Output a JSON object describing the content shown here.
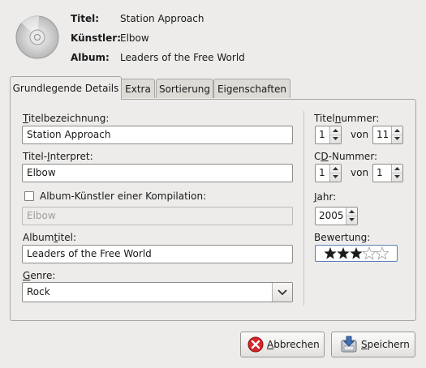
{
  "header": {
    "title_label": "Titel:",
    "title_value": "Station Approach",
    "artist_label": "Künstler:",
    "artist_value": "Elbow",
    "album_label": "Album:",
    "album_value": "Leaders of the Free World"
  },
  "tabs": [
    {
      "label": "Grundlegende Details",
      "active": true
    },
    {
      "label": "Extra",
      "active": false
    },
    {
      "label": "Sortierung",
      "active": false
    },
    {
      "label": "Eigenschaften",
      "active": false
    }
  ],
  "form": {
    "title_label_pre": "T",
    "title_label_rest": "itelbezeichnung:",
    "title_value": "Station Approach",
    "artist_label_pre": "Titel-",
    "artist_label_ul": "I",
    "artist_label_rest": "nterpret:",
    "artist_value": "Elbow",
    "compilation_label": "Album-Künstler einer Kompilation:",
    "compilation_checked": false,
    "compilation_value": "Elbow",
    "album_label_pre": "Album",
    "album_label_ul": "t",
    "album_label_rest": "itel:",
    "album_value": "Leaders of the Free World",
    "genre_label_ul": "G",
    "genre_label_rest": "enre:",
    "genre_value": "Rock"
  },
  "side": {
    "track_label_pre": "Titel",
    "track_label_ul": "n",
    "track_label_rest": "ummer:",
    "track_number": "1",
    "track_of": "von",
    "track_total": "11",
    "disc_label_pre": "C",
    "disc_label_ul": "D",
    "disc_label_rest": "-Nummer:",
    "disc_number": "1",
    "disc_of": "von",
    "disc_total": "1",
    "year_label_ul": "J",
    "year_label_rest": "ahr:",
    "year_value": "2005",
    "rating_label": "Bewertung:",
    "rating_value": 3,
    "rating_max": 5
  },
  "buttons": {
    "cancel_ul": "A",
    "cancel_rest": "bbrechen",
    "save_ul": "S",
    "save_rest": "peichern"
  },
  "colors": {
    "cancel_icon": "#d8262a",
    "save_icon": "#3f6fb4"
  },
  "icons": [
    "cd-icon",
    "cancel-icon",
    "save-icon",
    "chevron-down-icon",
    "star-icon"
  ]
}
